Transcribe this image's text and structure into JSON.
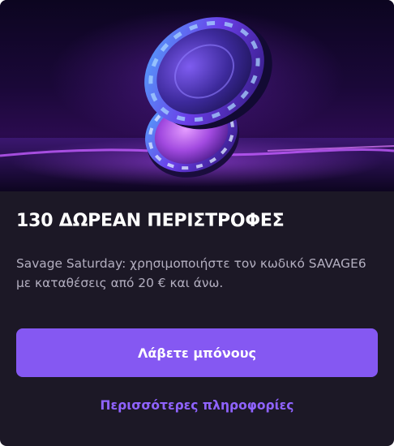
{
  "promo": {
    "hero_image": "casino-chips-image",
    "title": "130 ΔΩΡΕΑΝ ΠΕΡΙΣΤΡΟΦΕΣ",
    "description": "Savage Saturday: χρησιμοποιήστε τον κωδικό SAVAGE6 με καταθέσεις από 20 € και άνω.",
    "cta_label": "Λάβετε μπόνους",
    "more_info_label": "Περισσότερες πληροφορίες"
  },
  "colors": {
    "card_background": "#1c1826",
    "title": "#ffffff",
    "description": "#b3afc0",
    "button": "#8558f2",
    "link": "#8f63ff"
  }
}
